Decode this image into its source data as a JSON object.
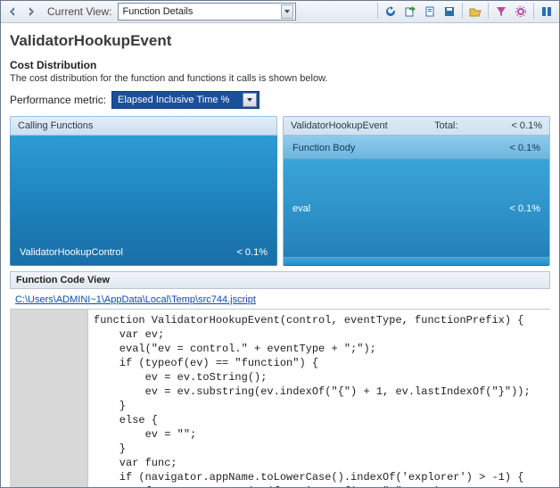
{
  "toolbar": {
    "view_label": "Current View:",
    "view_value": "Function Details",
    "nav_back_icon": "arrow-left",
    "nav_fwd_icon": "arrow-right"
  },
  "page": {
    "title": "ValidatorHookupEvent",
    "cost_heading": "Cost Distribution",
    "cost_subtitle": "The cost distribution for the function and functions it calls is shown below.",
    "metric_label": "Performance metric:",
    "metric_value": "Elapsed Inclusive Time %"
  },
  "callers": {
    "heading": "Calling Functions",
    "rows": [
      {
        "name": "ValidatorHookupControl",
        "value": "< 0.1%"
      }
    ]
  },
  "current": {
    "heading": "ValidatorHookupEvent",
    "total_label": "Total:",
    "total_value": "< 0.1%",
    "rows": [
      {
        "name": "Function Body",
        "value": "< 0.1%"
      },
      {
        "name": "eval",
        "value": "< 0.1%"
      }
    ]
  },
  "codeview": {
    "heading": "Function Code View",
    "path": "C:\\Users\\ADMINI~1\\AppData\\Local\\Temp\\src744.jscript",
    "code": "function ValidatorHookupEvent(control, eventType, functionPrefix) {\n    var ev;\n    eval(\"ev = control.\" + eventType + \";\");\n    if (typeof(ev) == \"function\") {\n        ev = ev.toString();\n        ev = ev.substring(ev.indexOf(\"{\") + 1, ev.lastIndexOf(\"}\"));\n    }\n    else {\n        ev = \"\";\n    }\n    var func;\n    if (navigator.appName.toLowerCase().indexOf('explorer') > -1) {\n        func = new Function(functionPrefix + \" \" + ev);"
  }
}
